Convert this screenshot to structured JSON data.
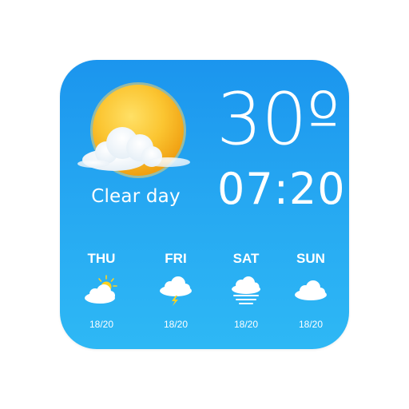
{
  "current": {
    "condition": "Clear day",
    "temperature": "30º",
    "time": "07:20",
    "icon": "sun-with-cloud-icon"
  },
  "forecast": [
    {
      "day": "THU",
      "range": "18/20",
      "icon": "partly-sunny-icon"
    },
    {
      "day": "FRI",
      "range": "18/20",
      "icon": "thunderstorm-icon"
    },
    {
      "day": "SAT",
      "range": "18/20",
      "icon": "fog-icon"
    },
    {
      "day": "SUN",
      "range": "18/20",
      "icon": "cloud-icon"
    }
  ],
  "colors": {
    "background_top": "#1b95ee",
    "background_bottom": "#2eb8f5",
    "sun": "#f7b21c",
    "bolt": "#ffd21e"
  }
}
